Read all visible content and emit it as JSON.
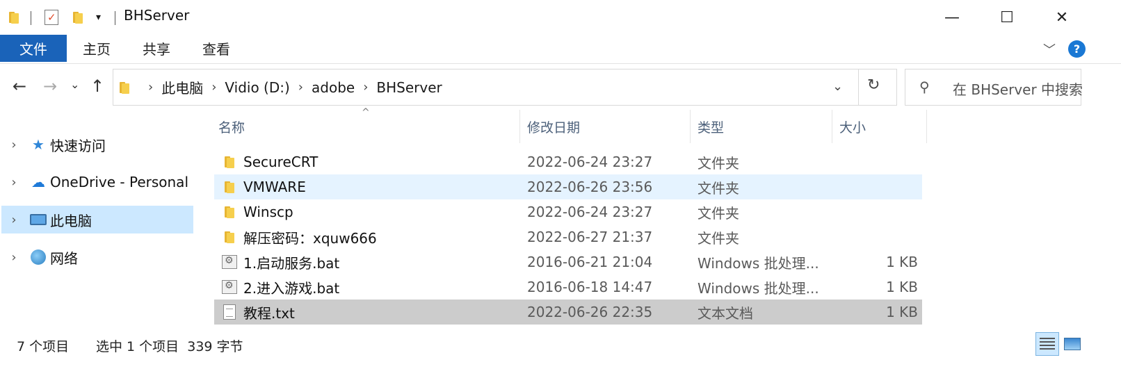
{
  "window": {
    "title": "BHServer",
    "minimize_glyph": "—",
    "maximize_glyph": "☐",
    "close_glyph": "✕"
  },
  "ribbon": {
    "tabs": [
      "文件",
      "主页",
      "共享",
      "查看"
    ],
    "collapse_glyph": "﹀",
    "help_glyph": "?"
  },
  "nav": {
    "back": "←",
    "forward": "→",
    "recent": "⌄",
    "up": "↑",
    "breadcrumbs": [
      "此电脑",
      "Vidio (D:)",
      "adobe",
      "BHServer"
    ],
    "crumb_sep": "›",
    "dropdown_glyph": "⌄",
    "refresh_glyph": "↻",
    "search_placeholder": "在 BHServer 中搜索"
  },
  "sidebar": {
    "items": [
      {
        "label": "快速访问",
        "icon": "star-icon",
        "chev": "›"
      },
      {
        "label": "OneDrive - Personal",
        "icon": "cloud-icon",
        "chev": "›"
      },
      {
        "label": "此电脑",
        "icon": "computer-icon",
        "chev": "›",
        "selected": true
      },
      {
        "label": "网络",
        "icon": "network-icon",
        "chev": "›"
      }
    ]
  },
  "columns": {
    "name": "名称",
    "date": "修改日期",
    "type": "类型",
    "size": "大小",
    "sort_glyph": "^"
  },
  "files": [
    {
      "name": "SecureCRT",
      "date": "2022-06-24 23:27",
      "type": "文件夹",
      "size": "",
      "icon": "folder-icon"
    },
    {
      "name": "VMWARE",
      "date": "2022-06-26 23:56",
      "type": "文件夹",
      "size": "",
      "icon": "folder-icon",
      "state": "hover"
    },
    {
      "name": "Winscp",
      "date": "2022-06-24 23:27",
      "type": "文件夹",
      "size": "",
      "icon": "folder-icon"
    },
    {
      "name": "解压密码：xquw666",
      "date": "2022-06-27 21:37",
      "type": "文件夹",
      "size": "",
      "icon": "folder-icon"
    },
    {
      "name": "1.启动服务.bat",
      "date": "2016-06-21 21:04",
      "type": "Windows 批处理...",
      "size": "1 KB",
      "icon": "batch-file-icon"
    },
    {
      "name": "2.进入游戏.bat",
      "date": "2016-06-18 14:47",
      "type": "Windows 批处理...",
      "size": "1 KB",
      "icon": "batch-file-icon"
    },
    {
      "name": "教程.txt",
      "date": "2022-06-26 22:35",
      "type": "文本文档",
      "size": "1 KB",
      "icon": "text-file-icon",
      "state": "selected"
    }
  ],
  "status": {
    "count": "7 个项目",
    "selection": "选中 1 个项目  339 字节"
  },
  "colors": {
    "file_tab": "#1a63b9",
    "selection": "#cce8ff",
    "hover": "#e5f3ff",
    "selected_row": "#cccccc",
    "folder": "#f6cf4d"
  }
}
